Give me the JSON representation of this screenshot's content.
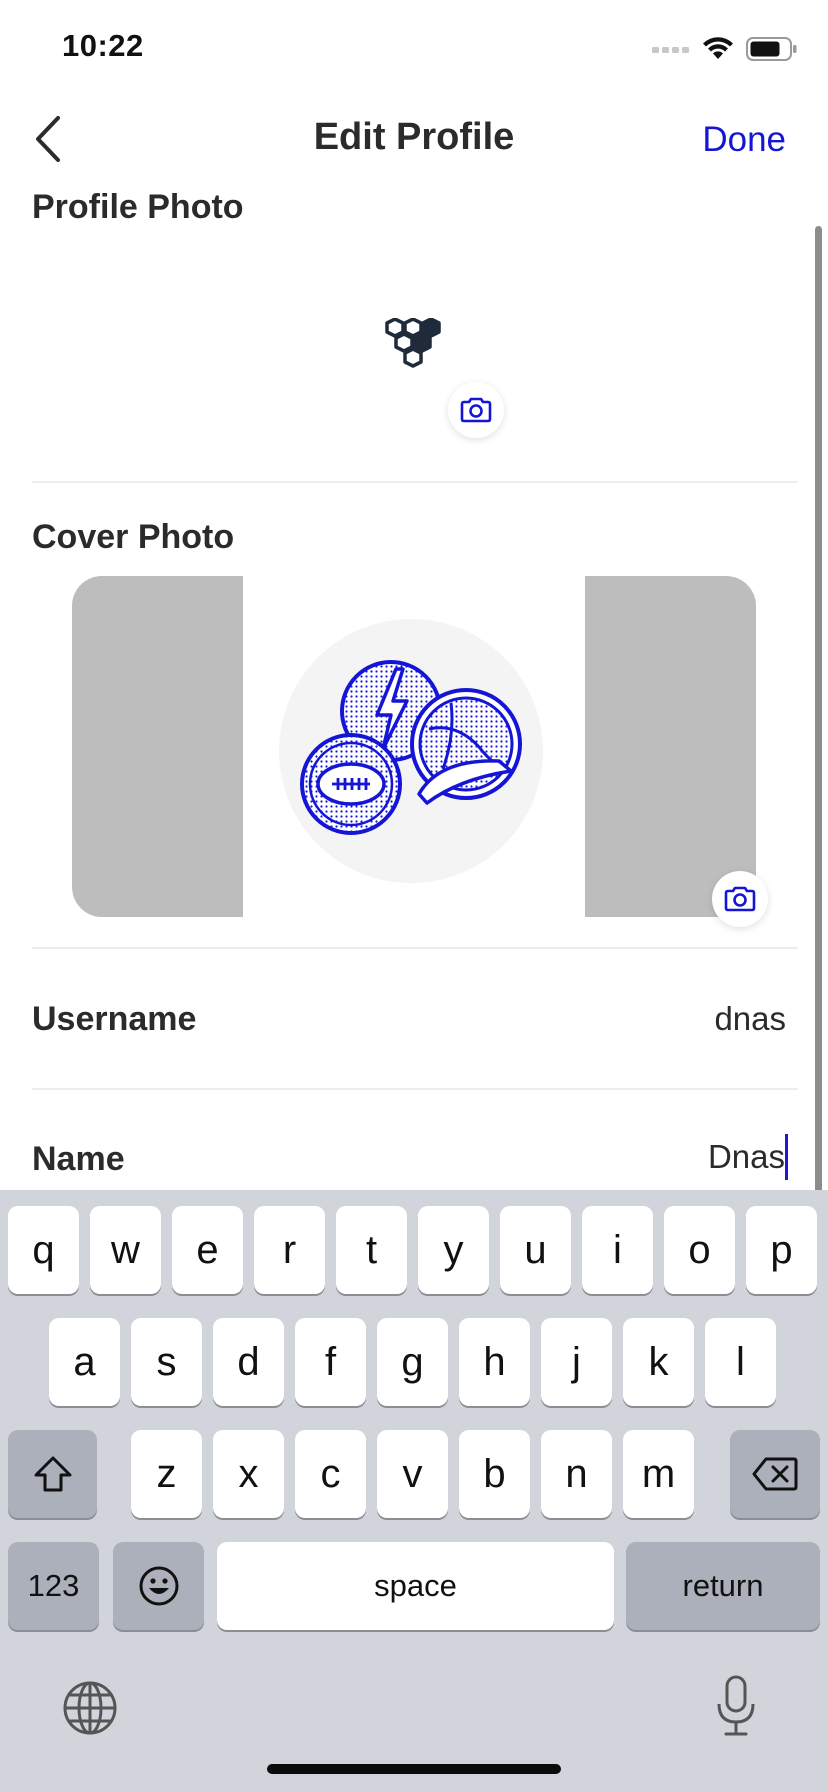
{
  "status": {
    "time": "10:22"
  },
  "nav": {
    "title": "Edit Profile",
    "done_label": "Done"
  },
  "sections": {
    "profile_photo_label": "Profile Photo",
    "cover_photo_label": "Cover Photo"
  },
  "fields": {
    "username": {
      "label": "Username",
      "value": "dnas"
    },
    "name": {
      "label": "Name",
      "value": "Dnas"
    }
  },
  "keyboard": {
    "row1": [
      "q",
      "w",
      "e",
      "r",
      "t",
      "y",
      "u",
      "i",
      "o",
      "p"
    ],
    "row2": [
      "a",
      "s",
      "d",
      "f",
      "g",
      "h",
      "j",
      "k",
      "l"
    ],
    "row3": [
      "z",
      "x",
      "c",
      "v",
      "b",
      "n",
      "m"
    ],
    "numbers_label": "123",
    "space_label": "space",
    "return_label": "return"
  },
  "colors": {
    "accent": "#1515d6",
    "text": "#2b2b2b",
    "keyboard_bg": "#d1d4db",
    "placeholder_gray": "#bdbdbd"
  },
  "icons": [
    "back-chevron-icon",
    "wifi-icon",
    "battery-icon",
    "signal-icon",
    "camera-icon",
    "emoji-icon",
    "shift-icon",
    "delete-icon",
    "globe-icon",
    "microphone-icon"
  ]
}
